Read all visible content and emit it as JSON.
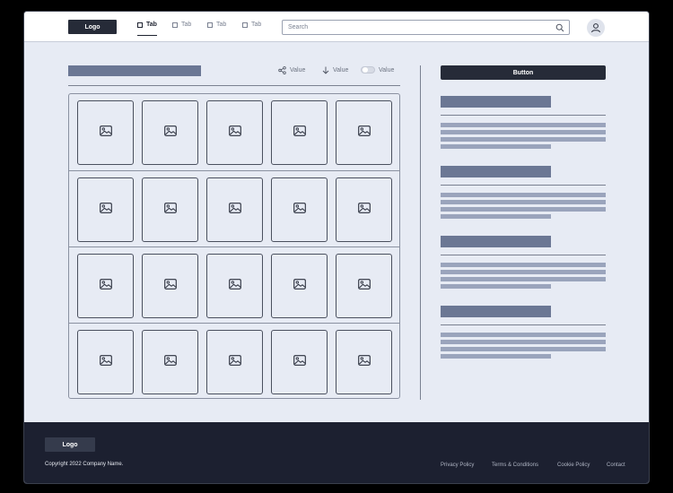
{
  "header": {
    "logo": "Logo",
    "tabs": [
      {
        "label": "Tab",
        "active": true
      },
      {
        "label": "Tab",
        "active": false
      },
      {
        "label": "Tab",
        "active": false
      },
      {
        "label": "Tab",
        "active": false
      }
    ],
    "search_placeholder": "Search",
    "search_icon": "search-icon",
    "avatar_icon": "user-icon"
  },
  "toolbar": {
    "share_label": "Value",
    "sort_label": "Value",
    "toggle_label": "Value",
    "toggle_on": false
  },
  "gallery": {
    "rows": 4,
    "columns": 5,
    "item_icon": "image-icon"
  },
  "sidebar": {
    "button_label": "Button"
  },
  "footer": {
    "logo": "Logo",
    "copyright": "Copyright 2022 Company Name.",
    "links": [
      "Privacy Policy",
      "Terms & Conditions",
      "Cookie Policy",
      "Contact"
    ]
  },
  "colors": {
    "dark": "#262b38",
    "background": "#e7ebf4",
    "placeholder_dark": "#6b7794",
    "placeholder_light": "#9aa4bc",
    "footer": "#1c2030"
  }
}
